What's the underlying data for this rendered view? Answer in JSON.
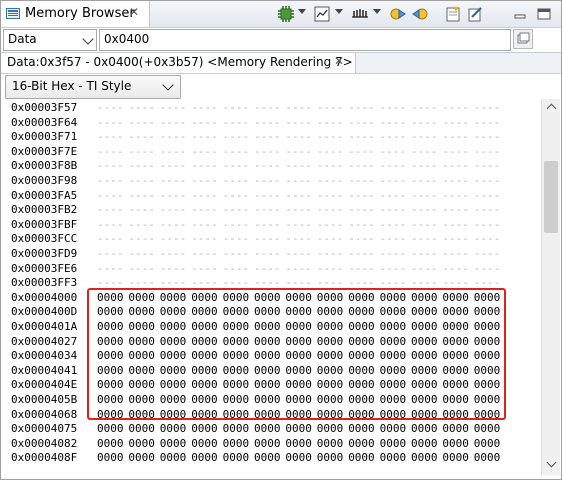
{
  "view": {
    "title": "Memory Browser",
    "close_glyph": "✕"
  },
  "toolbar": {
    "icons": [
      "refresh-chip-icon",
      "dropdown-icon",
      "memory-window-icon",
      "dropdown-icon",
      "memory-bytes-icon",
      "dropdown-icon",
      "go-back-icon",
      "go-forward-icon",
      "new-tab-icon",
      "edit-icon",
      "minimize-icon",
      "maximize-icon"
    ]
  },
  "address_bar": {
    "memory_space": "Data",
    "address_value": "0x0400",
    "go_icon": "go-icon"
  },
  "rendering_tab": {
    "label": "Data:0x3f57 - 0x0400(+0x3b57) <Memory Rendering 7>",
    "close_glyph": "✕"
  },
  "format": {
    "selected": "16-Bit Hex - TI Style"
  },
  "memory": {
    "empty_word": "----",
    "filled_word": "0000",
    "words_per_row": 13,
    "rows": [
      {
        "address": "0x00003F57",
        "filled": false
      },
      {
        "address": "0x00003F64",
        "filled": false
      },
      {
        "address": "0x00003F71",
        "filled": false
      },
      {
        "address": "0x00003F7E",
        "filled": false
      },
      {
        "address": "0x00003F8B",
        "filled": false
      },
      {
        "address": "0x00003F98",
        "filled": false
      },
      {
        "address": "0x00003FA5",
        "filled": false
      },
      {
        "address": "0x00003FB2",
        "filled": false
      },
      {
        "address": "0x00003FBF",
        "filled": false
      },
      {
        "address": "0x00003FCC",
        "filled": false
      },
      {
        "address": "0x00003FD9",
        "filled": false
      },
      {
        "address": "0x00003FE6",
        "filled": false
      },
      {
        "address": "0x00003FF3",
        "filled": false
      },
      {
        "address": "0x00004000",
        "filled": true
      },
      {
        "address": "0x0000400D",
        "filled": true
      },
      {
        "address": "0x0000401A",
        "filled": true
      },
      {
        "address": "0x00004027",
        "filled": true
      },
      {
        "address": "0x00004034",
        "filled": true
      },
      {
        "address": "0x00004041",
        "filled": true
      },
      {
        "address": "0x0000404E",
        "filled": true
      },
      {
        "address": "0x0000405B",
        "filled": true
      },
      {
        "address": "0x00004068",
        "filled": true
      },
      {
        "address": "0x00004075",
        "filled": true
      },
      {
        "address": "0x00004082",
        "filled": true
      },
      {
        "address": "0x0000408F",
        "filled": true
      }
    ]
  },
  "colors": {
    "highlight": "#e0221c",
    "empty_word": "#b4b4b4"
  }
}
